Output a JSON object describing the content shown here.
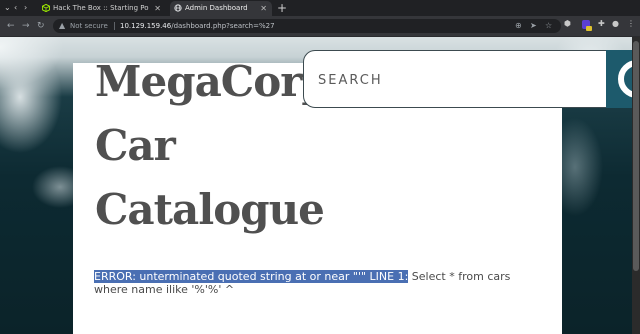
{
  "browser": {
    "tabs": [
      {
        "label": "Hack The Box :: Starting Po",
        "active": false,
        "favicon": "hackthebox-cube-icon",
        "color": "#9fef00"
      },
      {
        "label": "Admin Dashboard",
        "active": true,
        "favicon": "globe-icon"
      }
    ],
    "new_tab_label": "+",
    "address": {
      "security_label": "Not secure",
      "host": "10.129.159.46",
      "path": "/dashboard.php?search=%27"
    }
  },
  "page": {
    "title": "MegaCorp Car Catalogue",
    "search_placeholder": "SEARCH",
    "search_button_color": "#1d5a6c",
    "error_highlight": "ERROR: unterminated quoted string at or near \"'\" LINE 1:",
    "error_rest": " Select * from cars where name ilike '%'%' ^"
  }
}
